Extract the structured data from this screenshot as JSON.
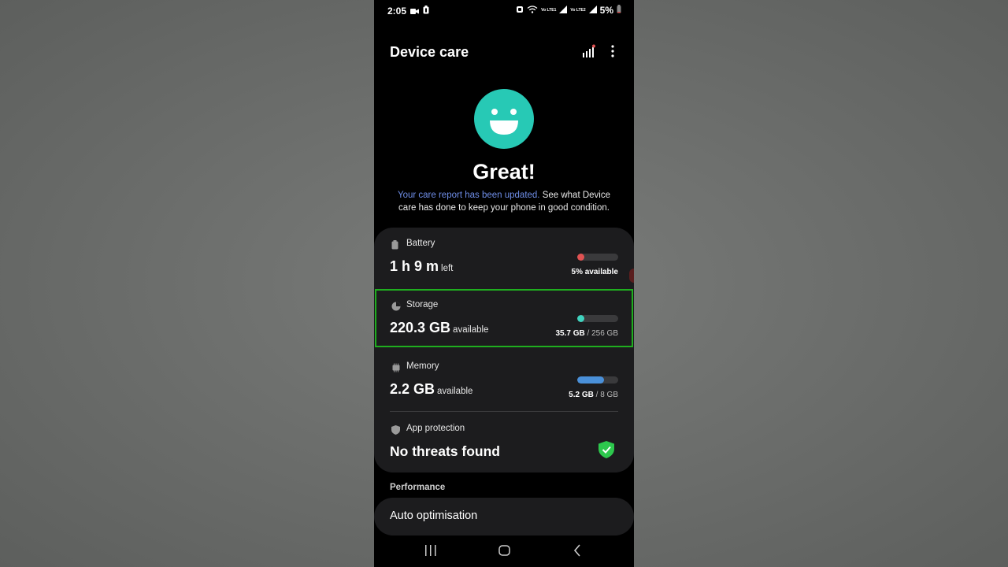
{
  "status_bar": {
    "time": "2:05",
    "battery_percent": "5%",
    "network_labels": [
      "Vo LTE1",
      "Vo LTE2"
    ],
    "icons": [
      "video-icon",
      "battery-saver-icon",
      "alarm-icon",
      "wifi-icon",
      "signal-icon",
      "battery-icon"
    ]
  },
  "header": {
    "title": "Device care",
    "icons": [
      "chart-icon",
      "more-options-icon"
    ]
  },
  "hero": {
    "status": "Great!",
    "link_text": "Your care report has been updated.",
    "description": " See what Device care has done to keep your phone in good condition."
  },
  "items": {
    "battery": {
      "label": "Battery",
      "value": "1 h 9 m",
      "unit": "left",
      "meta": "5% available",
      "level": 0.05,
      "color": "#e05252"
    },
    "storage": {
      "label": "Storage",
      "value": "220.3 GB",
      "unit": "available",
      "used": "35.7 GB",
      "total": "/ 256 GB",
      "level": 0.14,
      "color": "#3fd3bf"
    },
    "memory": {
      "label": "Memory",
      "value": "2.2 GB",
      "unit": "available",
      "used": "5.2 GB",
      "total": "/ 8 GB",
      "level": 0.65,
      "color": "#4a90d9"
    },
    "app_protection": {
      "label": "App protection",
      "value": "No threats found",
      "shield_color": "#2dc84d"
    }
  },
  "performance": {
    "section_title": "Performance",
    "auto_optimisation": "Auto optimisation"
  },
  "highlight_color": "#1fae1f",
  "navbar": [
    "recents-icon",
    "home-icon",
    "back-icon"
  ]
}
